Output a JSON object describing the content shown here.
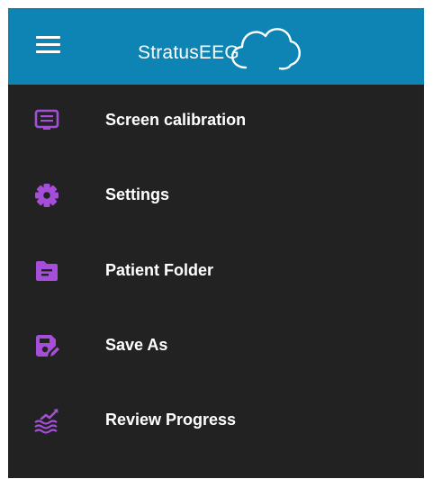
{
  "app": {
    "logo_text": "StratusEEG"
  },
  "colors": {
    "header_bg": "#0d84b4",
    "menu_bg": "#222222",
    "icon_accent": "#a44ed9",
    "text": "#ffffff"
  },
  "menu": {
    "items": [
      {
        "label": "Screen calibration",
        "icon": "monitor-icon"
      },
      {
        "label": "Settings",
        "icon": "gear-icon"
      },
      {
        "label": "Patient Folder",
        "icon": "folder-icon"
      },
      {
        "label": "Save As",
        "icon": "save-as-icon"
      },
      {
        "label": "Review Progress",
        "icon": "review-progress-icon"
      }
    ]
  }
}
